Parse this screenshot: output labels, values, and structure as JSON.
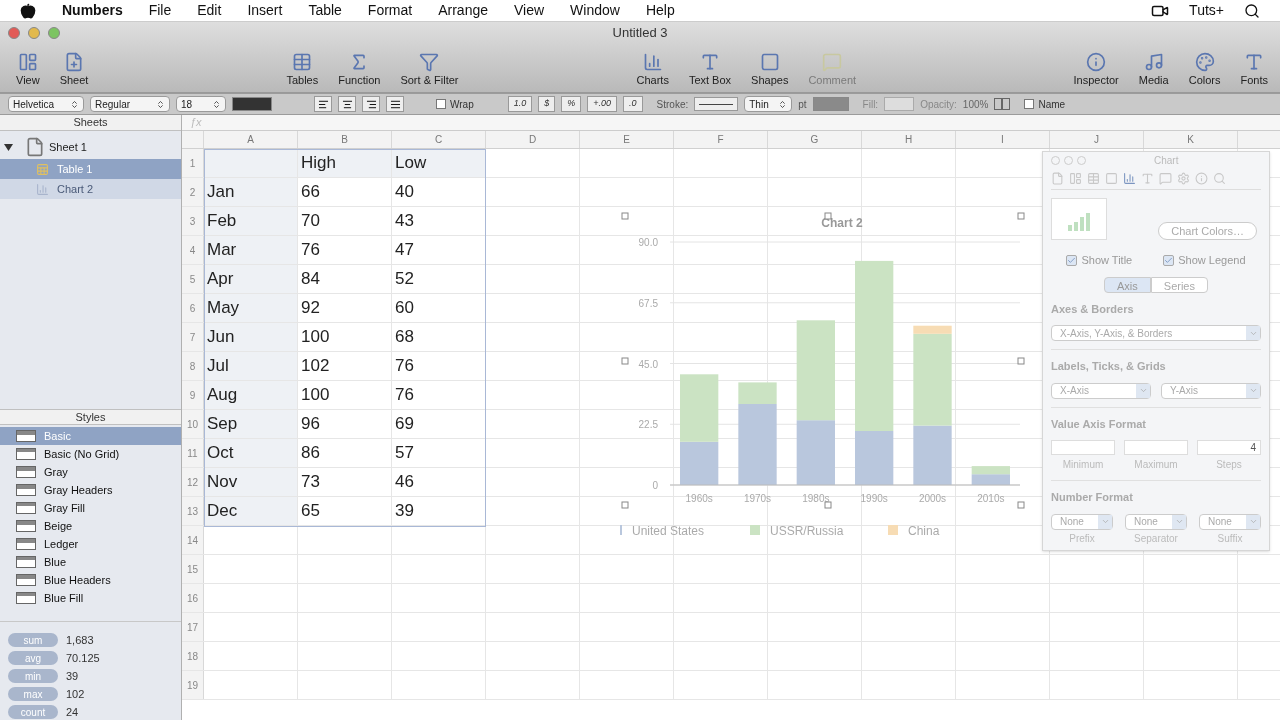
{
  "menu_bar": {
    "app": "Numbers",
    "items": [
      "File",
      "Edit",
      "Insert",
      "Table",
      "Format",
      "Arrange",
      "View",
      "Window",
      "Help"
    ],
    "right_label": "Tuts+"
  },
  "window": {
    "title": "Untitled 3"
  },
  "toolbar": [
    {
      "items": [
        {
          "kind": "view",
          "label": "View",
          "disabled": false
        },
        {
          "kind": "sheet",
          "label": "Sheet",
          "disabled": false
        }
      ]
    },
    {
      "items": [
        {
          "kind": "tables",
          "label": "Tables",
          "disabled": false
        },
        {
          "kind": "function",
          "label": "Function",
          "disabled": false
        },
        {
          "kind": "filter",
          "label": "Sort & Filter",
          "disabled": false
        }
      ]
    },
    {
      "items": [
        {
          "kind": "charts",
          "label": "Charts",
          "disabled": false
        },
        {
          "kind": "textbox",
          "label": "Text Box",
          "disabled": false
        },
        {
          "kind": "shapes",
          "label": "Shapes",
          "disabled": false
        },
        {
          "kind": "comment",
          "label": "Comment",
          "disabled": true
        }
      ]
    },
    {
      "items": [
        {
          "kind": "inspector",
          "label": "Inspector",
          "disabled": false
        },
        {
          "kind": "media",
          "label": "Media",
          "disabled": false
        },
        {
          "kind": "colors",
          "label": "Colors",
          "disabled": false
        },
        {
          "kind": "fonts",
          "label": "Fonts",
          "disabled": false
        }
      ]
    }
  ],
  "format_bar": {
    "font": "Helvetica",
    "typeface": "Regular",
    "size": "18",
    "wrap": {
      "label": "Wrap",
      "checked": false
    },
    "number_buttons": [
      "1.0",
      "$",
      "%",
      "+.00",
      ".0"
    ],
    "stroke_label": "Stroke:",
    "stroke_width": "Thin",
    "stroke_unit": "pt",
    "fill_label": "Fill:",
    "opacity_label": "Opacity:",
    "opacity": "100%",
    "name": {
      "label": "Name",
      "checked": false
    }
  },
  "formula_bar": {
    "fx": "ƒx"
  },
  "sidebar": {
    "sheets_title": "Sheets",
    "tree": [
      {
        "label": "Sheet 1",
        "expanded": true,
        "children": [
          {
            "label": "Table 1",
            "kind": "table",
            "selected": true
          },
          {
            "label": "Chart 2",
            "kind": "chart",
            "selected": false
          }
        ]
      }
    ],
    "styles_title": "Styles",
    "styles": [
      {
        "label": "Basic",
        "selected": true
      },
      {
        "label": "Basic (No Grid)",
        "selected": false
      },
      {
        "label": "Gray",
        "selected": false
      },
      {
        "label": "Gray Headers",
        "selected": false
      },
      {
        "label": "Gray Fill",
        "selected": false
      },
      {
        "label": "Beige",
        "selected": false
      },
      {
        "label": "Ledger",
        "selected": false
      },
      {
        "label": "Blue",
        "selected": false
      },
      {
        "label": "Blue Headers",
        "selected": false
      },
      {
        "label": "Blue Fill",
        "selected": false
      }
    ],
    "stats": [
      {
        "label": "sum",
        "value": "1,683"
      },
      {
        "label": "avg",
        "value": "70.125"
      },
      {
        "label": "min",
        "value": "39"
      },
      {
        "label": "max",
        "value": "102"
      },
      {
        "label": "count",
        "value": "24"
      }
    ]
  },
  "sheet": {
    "columns": [
      "A",
      "B",
      "C",
      "D",
      "E",
      "F",
      "G",
      "H",
      "I",
      "J",
      "K"
    ],
    "row_numbers": [
      "1",
      "2",
      "3",
      "4",
      "5",
      "6",
      "7",
      "8",
      "9",
      "10",
      "11",
      "12",
      "13",
      "14",
      "15",
      "16",
      "17",
      "18",
      "19"
    ],
    "table": {
      "header": [
        "High",
        "Low"
      ],
      "rows": [
        {
          "label": "Jan",
          "values": [
            "66",
            "40"
          ]
        },
        {
          "label": "Feb",
          "values": [
            "70",
            "43"
          ]
        },
        {
          "label": "Mar",
          "values": [
            "76",
            "47"
          ]
        },
        {
          "label": "Apr",
          "values": [
            "84",
            "52"
          ]
        },
        {
          "label": "May",
          "values": [
            "92",
            "60"
          ]
        },
        {
          "label": "Jun",
          "values": [
            "100",
            "68"
          ]
        },
        {
          "label": "Jul",
          "values": [
            "102",
            "76"
          ]
        },
        {
          "label": "Aug",
          "values": [
            "100",
            "76"
          ]
        },
        {
          "label": "Sep",
          "values": [
            "96",
            "69"
          ]
        },
        {
          "label": "Oct",
          "values": [
            "86",
            "57"
          ]
        },
        {
          "label": "Nov",
          "values": [
            "73",
            "46"
          ]
        },
        {
          "label": "Dec",
          "values": [
            "65",
            "39"
          ]
        }
      ]
    },
    "chart": {
      "chart_data": {
        "type": "bar",
        "title": "Chart 2",
        "stacked": true,
        "orientation": "vertical",
        "categories": [
          "1960s",
          "1970s",
          "1980s",
          "1990s",
          "2000s",
          "2010s"
        ],
        "series": [
          {
            "name": "United States",
            "color": "#b9c7dd",
            "values": [
              16,
              30,
              24,
              20,
              22,
              4
            ]
          },
          {
            "name": "USSR/Russia",
            "color": "#cbe3c3",
            "values": [
              25,
              8,
              37,
              63,
              34,
              3
            ]
          },
          {
            "name": "China",
            "color": "#f7dcb4",
            "values": [
              0,
              0,
              0,
              0,
              3,
              0
            ]
          }
        ],
        "grid": true,
        "legend": "bottom",
        "ylim": [
          0,
          90
        ],
        "yticks": [
          {
            "value": 0,
            "label": "0"
          },
          {
            "value": 22.5,
            "label": "22.5"
          },
          {
            "value": 45,
            "label": "45.0"
          },
          {
            "value": 67.5,
            "label": "67.5"
          },
          {
            "value": 90,
            "label": "90.0"
          }
        ]
      }
    }
  },
  "inspector": {
    "title": "Chart",
    "chart_colors": "Chart Colors…",
    "show_title": {
      "label": "Show Title",
      "checked": true
    },
    "show_legend": {
      "label": "Show Legend",
      "checked": true
    },
    "segments": [
      {
        "label": "Axis",
        "selected": true
      },
      {
        "label": "Series",
        "selected": false
      }
    ],
    "axes_heading": "Axes & Borders",
    "axes_value": "X-Axis, Y-Axis, & Borders",
    "labels_heading": "Labels, Ticks, & Grids",
    "labels_selects": [
      "X-Axis",
      "Y-Axis"
    ],
    "value_heading": "Value Axis Format",
    "value_fields": [
      {
        "label": "Minimum"
      },
      {
        "label": "Maximum"
      },
      {
        "label": "Steps",
        "value": "4"
      }
    ],
    "number_heading": "Number Format",
    "number_selects": [
      {
        "value": "None",
        "label": "Prefix"
      },
      {
        "value": "None",
        "label": "Separator"
      },
      {
        "value": "None",
        "label": "Suffix"
      }
    ]
  }
}
